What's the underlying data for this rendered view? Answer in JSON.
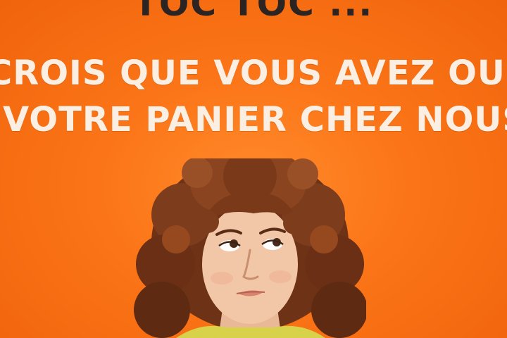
{
  "image": {
    "headline_top": "TOC TOC ...",
    "headline_line1": "CROIS QUE VOUS AVEZ OUB",
    "headline_line2": "VOTRE PANIER CHEZ NOUS",
    "colors": {
      "background": "#fb7417",
      "headline_top": "#2b2422",
      "headline_body": "#fbeee2",
      "hair": "#7a3a1a",
      "skin": "#f2c7a8",
      "shirt": "#d8d24a"
    }
  }
}
